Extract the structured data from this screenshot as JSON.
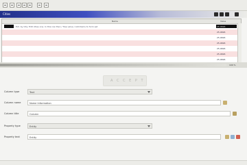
{
  "panel": {
    "title": "Cities"
  },
  "table": {
    "columns": [
      "",
      "Name",
      "Value"
    ],
    "rows": [
      {
        "text": "Ext. by City: Edit cities one. In this row then / Tree value / Add items to form set",
        "value": "25.4826",
        "selected": true
      },
      {
        "text": "",
        "value": "25.4826",
        "selected": false
      },
      {
        "text": "",
        "value": "25.4826",
        "selected": false
      },
      {
        "text": "",
        "value": "25.4826",
        "selected": false
      },
      {
        "text": "",
        "value": "25.4826",
        "selected": false
      },
      {
        "text": "",
        "value": "25.4826",
        "selected": false
      },
      {
        "text": "",
        "value": "25.4826",
        "selected": false
      }
    ]
  },
  "status": {
    "text": "100 %"
  },
  "form": {
    "action_label": "A C C E P T",
    "fields": [
      {
        "label": "Column type",
        "value": "Text"
      },
      {
        "label": "Column name",
        "value": "Name Information"
      },
      {
        "label": "Column title",
        "value": "Column"
      },
      {
        "label": "Property type",
        "value": "Entity"
      },
      {
        "label": "Property text",
        "value": "Entity"
      }
    ]
  }
}
